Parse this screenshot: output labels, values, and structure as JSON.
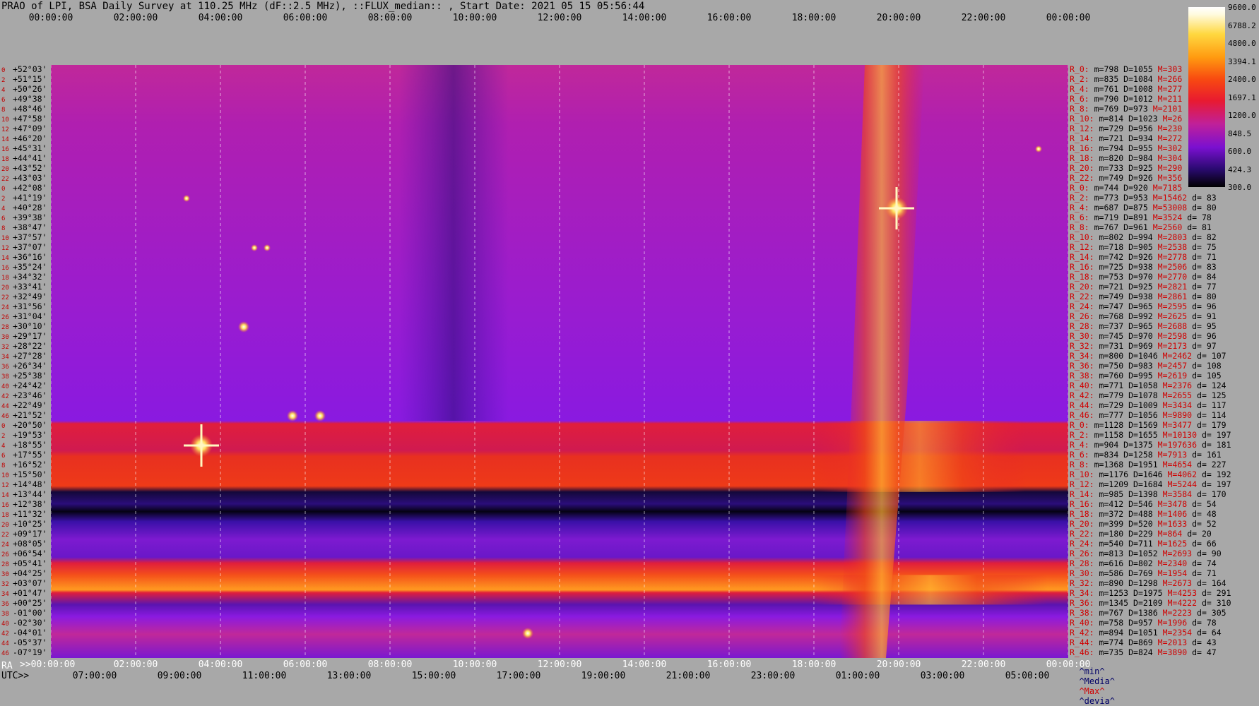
{
  "chart_data": {
    "type": "heatmap",
    "title": "PRAO of LPI, BSA Daily Survey at 110.25 MHz (dF::2.5 MHz), ::FLUX_median:: , Start Date: 2021 05 15 05:56:44",
    "x_top_labels": [
      "00:00:00",
      "02:00:00",
      "04:00:00",
      "06:00:00",
      "08:00:00",
      "10:00:00",
      "12:00:00",
      "14:00:00",
      "16:00:00",
      "18:00:00",
      "20:00:00",
      "22:00:00",
      "00:00:00"
    ],
    "x_bottom_ra_labels": [
      ">>00:00:00",
      "02:00:00",
      "04:00:00",
      "06:00:00",
      "08:00:00",
      "10:00:00",
      "12:00:00",
      "14:00:00",
      "16:00:00",
      "18:00:00",
      "20:00:00",
      "22:00:00",
      "00:00:00"
    ],
    "x_bottom_utc_labels": [
      "07:00:00",
      "09:00:00",
      "11:00:00",
      "13:00:00",
      "15:00:00",
      "17:00:00",
      "19:00:00",
      "21:00:00",
      "23:00:00",
      "01:00:00",
      "03:00:00",
      "05:00:00"
    ],
    "ra_label": "RA",
    "utc_label": "UTC>>",
    "colorbar_ticks": [
      "9600.0",
      "6788.2",
      "4800.0",
      "3394.1",
      "2400.0",
      "1697.1",
      "1200.0",
      "848.5",
      "600.0",
      "424.3",
      "300.0"
    ],
    "colorbar_range": [
      300,
      9600
    ],
    "colorbar_scale": "log",
    "dec_labels": [
      {
        "i": "0",
        "dec": "+52°03'"
      },
      {
        "i": "2",
        "dec": "+51°15'"
      },
      {
        "i": "4",
        "dec": "+50°26'"
      },
      {
        "i": "6",
        "dec": "+49°38'"
      },
      {
        "i": "8",
        "dec": "+48°46'"
      },
      {
        "i": "10",
        "dec": "+47°58'"
      },
      {
        "i": "12",
        "dec": "+47°09'"
      },
      {
        "i": "14",
        "dec": "+46°20'"
      },
      {
        "i": "16",
        "dec": "+45°31'"
      },
      {
        "i": "18",
        "dec": "+44°41'"
      },
      {
        "i": "20",
        "dec": "+43°52'"
      },
      {
        "i": "22",
        "dec": "+43°03'"
      },
      {
        "i": "0",
        "dec": "+42°08'"
      },
      {
        "i": "2",
        "dec": "+41°19'"
      },
      {
        "i": "4",
        "dec": "+40°28'"
      },
      {
        "i": "6",
        "dec": "+39°38'"
      },
      {
        "i": "8",
        "dec": "+38°47'"
      },
      {
        "i": "10",
        "dec": "+37°57'"
      },
      {
        "i": "12",
        "dec": "+37°07'"
      },
      {
        "i": "14",
        "dec": "+36°16'"
      },
      {
        "i": "16",
        "dec": "+35°24'"
      },
      {
        "i": "18",
        "dec": "+34°32'"
      },
      {
        "i": "20",
        "dec": "+33°41'"
      },
      {
        "i": "22",
        "dec": "+32°49'"
      },
      {
        "i": "24",
        "dec": "+31°56'"
      },
      {
        "i": "26",
        "dec": "+31°04'"
      },
      {
        "i": "28",
        "dec": "+30°10'"
      },
      {
        "i": "30",
        "dec": "+29°17'"
      },
      {
        "i": "32",
        "dec": "+28°22'"
      },
      {
        "i": "34",
        "dec": "+27°28'"
      },
      {
        "i": "36",
        "dec": "+26°34'"
      },
      {
        "i": "38",
        "dec": "+25°38'"
      },
      {
        "i": "40",
        "dec": "+24°42'"
      },
      {
        "i": "42",
        "dec": "+23°46'"
      },
      {
        "i": "44",
        "dec": "+22°49'"
      },
      {
        "i": "46",
        "dec": "+21°52'"
      },
      {
        "i": "0",
        "dec": "+20°50'"
      },
      {
        "i": "2",
        "dec": "+19°53'"
      },
      {
        "i": "4",
        "dec": "+18°55'"
      },
      {
        "i": "6",
        "dec": "+17°55'"
      },
      {
        "i": "8",
        "dec": "+16°52'"
      },
      {
        "i": "10",
        "dec": "+15°50'"
      },
      {
        "i": "12",
        "dec": "+14°48'"
      },
      {
        "i": "14",
        "dec": "+13°44'"
      },
      {
        "i": "16",
        "dec": "+12°38'"
      },
      {
        "i": "18",
        "dec": "+11°32'"
      },
      {
        "i": "20",
        "dec": "+10°25'"
      },
      {
        "i": "22",
        "dec": "+09°17'"
      },
      {
        "i": "24",
        "dec": "+08°05'"
      },
      {
        "i": "26",
        "dec": "+06°54'"
      },
      {
        "i": "28",
        "dec": "+05°41'"
      },
      {
        "i": "30",
        "dec": "+04°25'"
      },
      {
        "i": "32",
        "dec": "+03°07'"
      },
      {
        "i": "34",
        "dec": "+01°47'"
      },
      {
        "i": "36",
        "dec": "+00°25'"
      },
      {
        "i": "38",
        "dec": "-01°00'"
      },
      {
        "i": "40",
        "dec": "-02°30'"
      },
      {
        "i": "42",
        "dec": "-04°01'"
      },
      {
        "i": "44",
        "dec": "-05°37'"
      },
      {
        "i": "46",
        "dec": "-07°19'"
      }
    ],
    "row_stats": [
      {
        "r": "R_0:",
        "m": "798",
        "D": "1055",
        "M": "303",
        "d": ""
      },
      {
        "r": "R_2:",
        "m": "835",
        "D": "1084",
        "M": "266",
        "d": ""
      },
      {
        "r": "R_4:",
        "m": "761",
        "D": "1008",
        "M": "277",
        "d": ""
      },
      {
        "r": "R_6:",
        "m": "790",
        "D": "1012",
        "M": "211",
        "d": ""
      },
      {
        "r": "R_8:",
        "m": "769",
        "D": "973",
        "M": "2101",
        "d": ""
      },
      {
        "r": "R_10:",
        "m": "814",
        "D": "1023",
        "M": "26",
        "d": ""
      },
      {
        "r": "R_12:",
        "m": "729",
        "D": "956",
        "M": "230",
        "d": ""
      },
      {
        "r": "R_14:",
        "m": "721",
        "D": "934",
        "M": "272",
        "d": ""
      },
      {
        "r": "R_16:",
        "m": "794",
        "D": "955",
        "M": "302",
        "d": ""
      },
      {
        "r": "R_18:",
        "m": "820",
        "D": "984",
        "M": "304",
        "d": ""
      },
      {
        "r": "R_20:",
        "m": "733",
        "D": "925",
        "M": "290",
        "d": ""
      },
      {
        "r": "R_22:",
        "m": "749",
        "D": "926",
        "M": "356",
        "d": ""
      },
      {
        "r": "R_0:",
        "m": "744",
        "D": "920",
        "M": "7185",
        "d": ""
      },
      {
        "r": "R_2:",
        "m": "773",
        "D": "953",
        "M": "15462",
        "d": "83"
      },
      {
        "r": "R_4:",
        "m": "687",
        "D": "875",
        "M": "53008",
        "d": "80"
      },
      {
        "r": "R_6:",
        "m": "719",
        "D": "891",
        "M": "3524",
        "d": "78"
      },
      {
        "r": "R_8:",
        "m": "767",
        "D": "961",
        "M": "2560",
        "d": "81"
      },
      {
        "r": "R_10:",
        "m": "802",
        "D": "994",
        "M": "2803",
        "d": "82"
      },
      {
        "r": "R_12:",
        "m": "718",
        "D": "905",
        "M": "2538",
        "d": "75"
      },
      {
        "r": "R_14:",
        "m": "742",
        "D": "926",
        "M": "2778",
        "d": "71"
      },
      {
        "r": "R_16:",
        "m": "725",
        "D": "938",
        "M": "2506",
        "d": "83"
      },
      {
        "r": "R_18:",
        "m": "753",
        "D": "970",
        "M": "2770",
        "d": "84"
      },
      {
        "r": "R_20:",
        "m": "721",
        "D": "925",
        "M": "2821",
        "d": "77"
      },
      {
        "r": "R_22:",
        "m": "749",
        "D": "938",
        "M": "2861",
        "d": "80"
      },
      {
        "r": "R_24:",
        "m": "747",
        "D": "965",
        "M": "2595",
        "d": "96"
      },
      {
        "r": "R_26:",
        "m": "768",
        "D": "992",
        "M": "2625",
        "d": "91"
      },
      {
        "r": "R_28:",
        "m": "737",
        "D": "965",
        "M": "2688",
        "d": "95"
      },
      {
        "r": "R_30:",
        "m": "745",
        "D": "970",
        "M": "2598",
        "d": "96"
      },
      {
        "r": "R_32:",
        "m": "731",
        "D": "969",
        "M": "2173",
        "d": "97"
      },
      {
        "r": "R_34:",
        "m": "800",
        "D": "1046",
        "M": "2462",
        "d": "107"
      },
      {
        "r": "R_36:",
        "m": "750",
        "D": "983",
        "M": "2457",
        "d": "108"
      },
      {
        "r": "R_38:",
        "m": "760",
        "D": "995",
        "M": "2619",
        "d": "105"
      },
      {
        "r": "R_40:",
        "m": "771",
        "D": "1058",
        "M": "2376",
        "d": "124"
      },
      {
        "r": "R_42:",
        "m": "779",
        "D": "1078",
        "M": "2655",
        "d": "125"
      },
      {
        "r": "R_44:",
        "m": "729",
        "D": "1009",
        "M": "3434",
        "d": "117"
      },
      {
        "r": "R_46:",
        "m": "777",
        "D": "1056",
        "M": "9890",
        "d": "114"
      },
      {
        "r": "R_0:",
        "m": "1128",
        "D": "1569",
        "M": "3477",
        "d": "179"
      },
      {
        "r": "R_2:",
        "m": "1158",
        "D": "1655",
        "M": "10130",
        "d": "197"
      },
      {
        "r": "R_4:",
        "m": "904",
        "D": "1375",
        "M": "197636",
        "d": "181"
      },
      {
        "r": "R_6:",
        "m": "834",
        "D": "1258",
        "M": "7913",
        "d": "161"
      },
      {
        "r": "R_8:",
        "m": "1368",
        "D": "1951",
        "M": "4654",
        "d": "227"
      },
      {
        "r": "R_10:",
        "m": "1176",
        "D": "1646",
        "M": "4062",
        "d": "192"
      },
      {
        "r": "R_12:",
        "m": "1209",
        "D": "1684",
        "M": "5244",
        "d": "197"
      },
      {
        "r": "R_14:",
        "m": "985",
        "D": "1398",
        "M": "3584",
        "d": "170"
      },
      {
        "r": "R_16:",
        "m": "412",
        "D": "546",
        "M": "3478",
        "d": "54"
      },
      {
        "r": "R_18:",
        "m": "372",
        "D": "488",
        "M": "1406",
        "d": "48"
      },
      {
        "r": "R_20:",
        "m": "399",
        "D": "520",
        "M": "1633",
        "d": "52"
      },
      {
        "r": "R_22:",
        "m": "180",
        "D": "229",
        "M": "864",
        "d": "20"
      },
      {
        "r": "R_24:",
        "m": "540",
        "D": "711",
        "M": "1625",
        "d": "66"
      },
      {
        "r": "R_26:",
        "m": "813",
        "D": "1052",
        "M": "2693",
        "d": "90"
      },
      {
        "r": "R_28:",
        "m": "616",
        "D": "802",
        "M": "2340",
        "d": "74"
      },
      {
        "r": "R_30:",
        "m": "586",
        "D": "769",
        "M": "1954",
        "d": "71"
      },
      {
        "r": "R_32:",
        "m": "890",
        "D": "1298",
        "M": "2673",
        "d": "164"
      },
      {
        "r": "R_34:",
        "m": "1253",
        "D": "1975",
        "M": "4253",
        "d": "291"
      },
      {
        "r": "R_36:",
        "m": "1345",
        "D": "2109",
        "M": "4222",
        "d": "310"
      },
      {
        "r": "R_38:",
        "m": "767",
        "D": "1386",
        "M": "2223",
        "d": "305"
      },
      {
        "r": "R_40:",
        "m": "758",
        "D": "957",
        "M": "1996",
        "d": "78"
      },
      {
        "r": "R_42:",
        "m": "894",
        "D": "1051",
        "M": "2354",
        "d": "64"
      },
      {
        "r": "R_44:",
        "m": "774",
        "D": "869",
        "M": "2013",
        "d": "43"
      },
      {
        "r": "R_46:",
        "m": "735",
        "D": "824",
        "M": "3890",
        "d": "47"
      }
    ],
    "footer": {
      "min": "^min^",
      "median": "^Media^",
      "max": "^Max^",
      "devia": "^devia^"
    },
    "hot_spots": [
      {
        "ra_h": 3.55,
        "dec_row": 38,
        "level": "white"
      },
      {
        "ra_h": 19.95,
        "dec_row": 14,
        "level": "white"
      },
      {
        "ra_h": 5.7,
        "dec_row": 35,
        "level": "yellow"
      },
      {
        "ra_h": 6.35,
        "dec_row": 35,
        "level": "yellow"
      },
      {
        "ra_h": 11.25,
        "dec_row": 57,
        "level": "yellow"
      },
      {
        "ra_h": 4.55,
        "dec_row": 26,
        "level": "yellow"
      },
      {
        "ra_h": 23.3,
        "dec_row": 8,
        "level": "orange"
      },
      {
        "ra_h": 3.2,
        "dec_row": 13,
        "level": "orange"
      },
      {
        "ra_h": 4.8,
        "dec_row": 18,
        "level": "orange"
      },
      {
        "ra_h": 5.1,
        "dec_row": 18,
        "level": "orange"
      }
    ]
  }
}
